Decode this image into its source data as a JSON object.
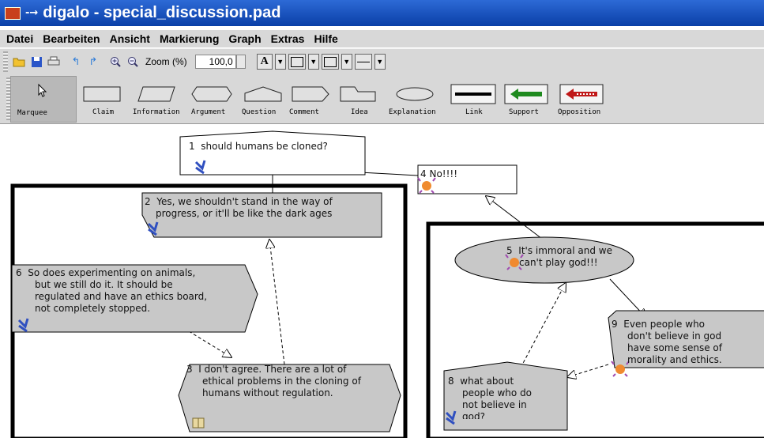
{
  "window": {
    "title": "digalo - special_discussion.pad",
    "pin": "-→"
  },
  "menu": [
    "Datei",
    "Bearbeiten",
    "Ansicht",
    "Markierung",
    "Graph",
    "Extras",
    "Hilfe"
  ],
  "toolbar": {
    "zoom_label": "Zoom (%)",
    "zoom_value": "100,0",
    "font_button": "A"
  },
  "tools": [
    "Marquee",
    "Claim",
    "Information",
    "Argument",
    "Question",
    "Comment",
    "Idea",
    "Explanation",
    "Link",
    "Support",
    "Opposition"
  ],
  "nodes": [
    {
      "num": "1",
      "text": [
        "should humans be cloned?"
      ]
    },
    {
      "num": "4",
      "text": [
        "No!!!!"
      ]
    },
    {
      "num": "2",
      "text": [
        "Yes, we shouldn't stand in the way of",
        "progress, or it'll be like the dark ages"
      ]
    },
    {
      "num": "6",
      "text": [
        "So does experimenting on animals,",
        "but we still do it. It should be",
        "regulated and have an ethics board,",
        "not completely stopped."
      ]
    },
    {
      "num": "3",
      "text": [
        "I don't agree. There are a lot of",
        "ethical problems in the cloning of",
        "humans without  regulation."
      ]
    },
    {
      "num": "5",
      "text": [
        "It's immoral and we",
        "can't play god!!!"
      ]
    },
    {
      "num": "9",
      "text": [
        "Even people who",
        "don't believe in god",
        "have some sense of",
        "morality and ethics."
      ]
    },
    {
      "num": "8",
      "text": [
        "what about",
        "people who do",
        "not believe in",
        "god?"
      ]
    }
  ],
  "colors": {
    "titlebar": "#0a3fa7",
    "toolbar": "#d8d8d8",
    "node_fill": "#c8c8c8",
    "support": "#1e8a1e",
    "opposition": "#c01818"
  }
}
